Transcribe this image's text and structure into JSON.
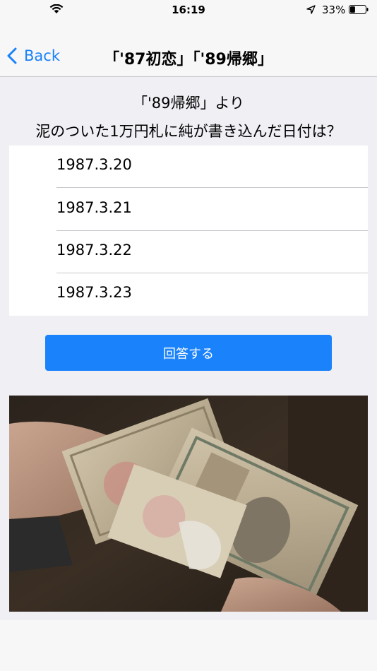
{
  "status_bar": {
    "time": "16:19",
    "battery_percent": "33%",
    "battery_level": 0.33,
    "icons": [
      "wifi-icon",
      "location-arrow-icon",
      "battery-icon"
    ]
  },
  "nav": {
    "back_label": "Back",
    "title": "「'87初恋」「'89帰郷」"
  },
  "question": {
    "line1": "「'89帰郷」より",
    "line2": "泥のついた1万円札に純が書き込んだ日付は？"
  },
  "options": [
    {
      "label": "1987.3.20"
    },
    {
      "label": "1987.3.21"
    },
    {
      "label": "1987.3.22"
    },
    {
      "label": "1987.3.23"
    }
  ],
  "answer_button": {
    "label": "回答する"
  },
  "colors": {
    "accent": "#1a82fb",
    "background": "#efeff4",
    "bar": "#f7f7f7",
    "separator": "#c8c7cc"
  }
}
